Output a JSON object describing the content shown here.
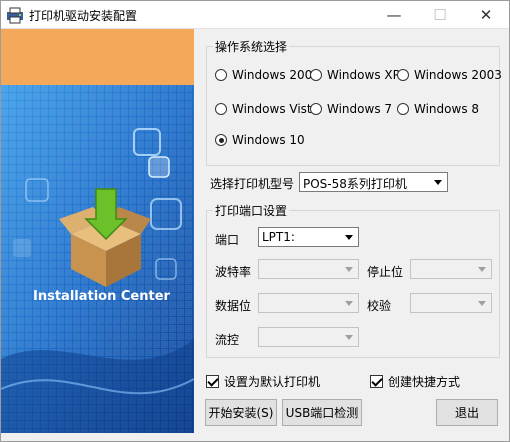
{
  "window": {
    "title": "打印机驱动安装配置",
    "minimize_label": "—",
    "maximize_label": "☐",
    "close_label": "✕"
  },
  "banner": {
    "caption": "Installation Center",
    "colors": {
      "orange": "#f4a85a",
      "blue_dark": "#0f4fa8",
      "blue_light": "#2d8fe0",
      "box": "#c8934f",
      "arrow": "#6cc12a"
    }
  },
  "os_group": {
    "legend": "操作系统选择",
    "options": [
      {
        "label": "Windows 2000",
        "selected": false
      },
      {
        "label": "Windows XP",
        "selected": false
      },
      {
        "label": "Windows 2003",
        "selected": false
      },
      {
        "label": "Windows Vista",
        "selected": false
      },
      {
        "label": "Windows 7",
        "selected": false
      },
      {
        "label": "Windows 8",
        "selected": false
      },
      {
        "label": "Windows 10",
        "selected": true
      }
    ]
  },
  "printer_model": {
    "label": "选择打印机型号",
    "value": "POS-58系列打印机"
  },
  "port_group": {
    "legend": "打印端口设置",
    "port_label": "端口",
    "port_value": "LPT1:",
    "baud_label": "波特率",
    "stop_label": "停止位",
    "data_label": "数据位",
    "parity_label": "校验",
    "flow_label": "流控"
  },
  "options": {
    "default_printer": {
      "label": "设置为默认打印机",
      "checked": true
    },
    "shortcut": {
      "label": "创建快捷方式",
      "checked": true
    }
  },
  "buttons": {
    "install": "开始安装(S)",
    "usb_detect": "USB端口检测",
    "exit": "退出"
  }
}
